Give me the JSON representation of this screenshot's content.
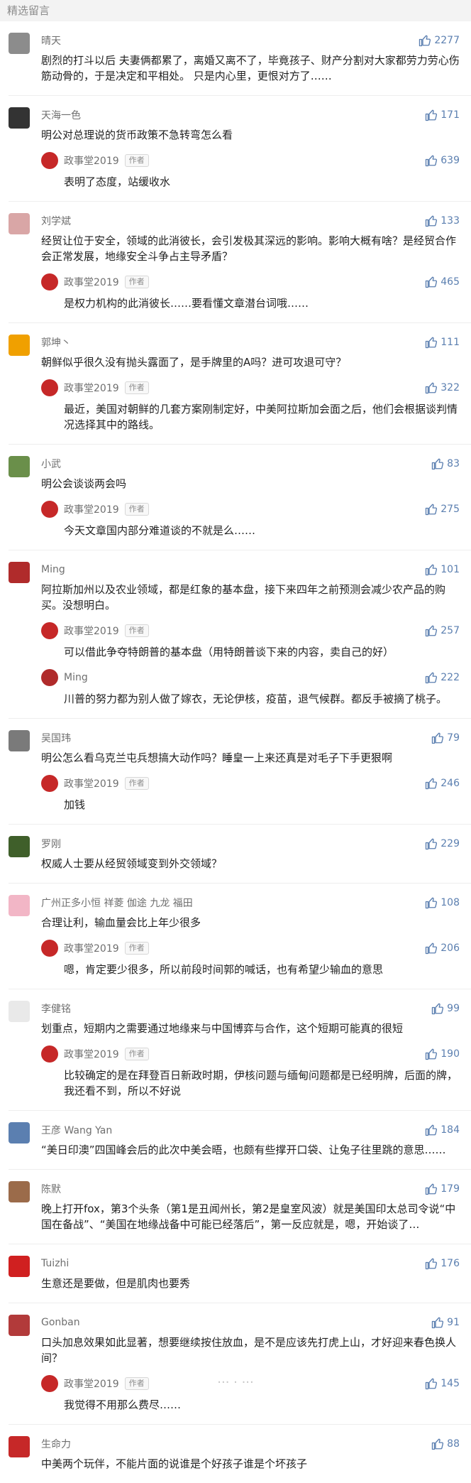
{
  "header": {
    "title": "精选留言"
  },
  "comments": [
    {
      "name": "晴天",
      "likes": "2277",
      "text": "剧烈的打斗以后 夫妻俩都累了，离婚又离不了，毕竟孩子、财产分割对大家都劳力劳心伤筋动骨的，于是决定和平相处。\n只是内心里，更恨对方了……"
    },
    {
      "name": "天海一色",
      "likes": "171",
      "text": "明公对总理说的货币政策不急转弯怎么看",
      "reply": {
        "name": "政事堂2019",
        "badge": "作者",
        "likes": "639",
        "text": "表明了态度，站缓收水"
      }
    },
    {
      "name": "刘学斌",
      "likes": "133",
      "text": "经贸让位于安全，领域的此消彼长，会引发极其深远的影响。影响大概有啥？是经贸合作会正常发展，地缘安全斗争占主导矛盾？",
      "reply": {
        "name": "政事堂2019",
        "badge": "作者",
        "likes": "465",
        "text": "是权力机构的此消彼长……要看懂文章潜台词哦……"
      }
    },
    {
      "name": "郭坤丶",
      "likes": "111",
      "text": "朝鲜似乎很久没有抛头露面了，是手牌里的A吗？进可攻退可守？",
      "reply": {
        "name": "政事堂2019",
        "badge": "作者",
        "likes": "322",
        "text": "最近，美国对朝鲜的几套方案刚制定好，中美阿拉斯加会面之后，他们会根据谈判情况选择其中的路线。"
      }
    },
    {
      "name": "小武",
      "likes": "83",
      "text": "明公会谈谈两会吗",
      "reply": {
        "name": "政事堂2019",
        "badge": "作者",
        "likes": "275",
        "text": "今天文章国内部分难道谈的不就是么……"
      }
    },
    {
      "name": "Ming",
      "likes": "101",
      "text": "阿拉斯加州以及农业领域，都是红象的基本盘，接下来四年之前预测会减少农产品的购买。没想明白。",
      "reply": {
        "name": "政事堂2019",
        "badge": "作者",
        "likes": "257",
        "text": "可以借此争夺特朗普的基本盘（用特朗普谈下来的内容，卖自己的好）"
      },
      "reply2": {
        "name": "Ming",
        "likes": "222",
        "text": "川普的努力都为别人做了嫁衣，无论伊核，疫苗，退气候群。都反手被摘了桃子。"
      }
    },
    {
      "name": "吴国玮",
      "likes": "79",
      "text": "明公怎么看乌克兰屯兵想搞大动作吗？睡皇一上来还真是对毛子下手更狠啊",
      "reply": {
        "name": "政事堂2019",
        "badge": "作者",
        "likes": "246",
        "text": "加钱"
      }
    },
    {
      "name": "罗刚",
      "likes": "229",
      "text": "权威人士要从经贸领域变到外交领域？"
    },
    {
      "name": "广州正多小恒 祥菱 伽途 九龙 福田",
      "likes": "108",
      "text": "合理让利，输血量会比上年少很多",
      "reply": {
        "name": "政事堂2019",
        "badge": "作者",
        "likes": "206",
        "text": "嗯，肯定要少很多，所以前段时间郭的喊话，也有希望少输血的意思"
      }
    },
    {
      "name": "李健铭",
      "likes": "99",
      "text": "划重点，短期内之需要通过地缘来与中国博弈与合作，这个短期可能真的很短",
      "reply": {
        "name": "政事堂2019",
        "badge": "作者",
        "likes": "190",
        "text": "比较确定的是在拜登百日新政时期，伊核问题与缅甸问题都是已经明牌，后面的牌，我还看不到，所以不好说"
      }
    },
    {
      "name": "王彦 Wang Yan",
      "likes": "184",
      "text": "“美日印澳”四国峰会后的此次中美会晤，也颇有些撑开口袋、让兔子往里跳的意思……"
    },
    {
      "name": "陈默",
      "likes": "179",
      "text": "晚上打开fox，第3个头条（第1是丑闻州长，第2是皇室风波）就是美国印太总司令说“中国在备战”、“美国在地缘战备中可能已经落后”，第一反应就是，嗯，开始谈了…"
    },
    {
      "name": "Tuizhi",
      "likes": "176",
      "text": "生意还是要做，但是肌肉也要秀"
    },
    {
      "name": "Gonban",
      "likes": "91",
      "text": "口头加息效果如此显著，想要继续按住放血，是不是应该先打虎上山，才好迎来春色换人间？",
      "reply": {
        "name": "政事堂2019",
        "badge": "作者",
        "likes": "145",
        "text": "我觉得不用那么费尽……"
      }
    },
    {
      "name": "生命力",
      "likes": "88",
      "text": "中美两个玩伴，不能片面的说谁是个好孩子谁是个坏孩子"
    }
  ],
  "colors": {
    "accent": "#5b7fb0",
    "muted": "#8b8b8b",
    "header_bg": "#f3f3f3"
  },
  "icons": {
    "like": "thumb-up-icon"
  }
}
